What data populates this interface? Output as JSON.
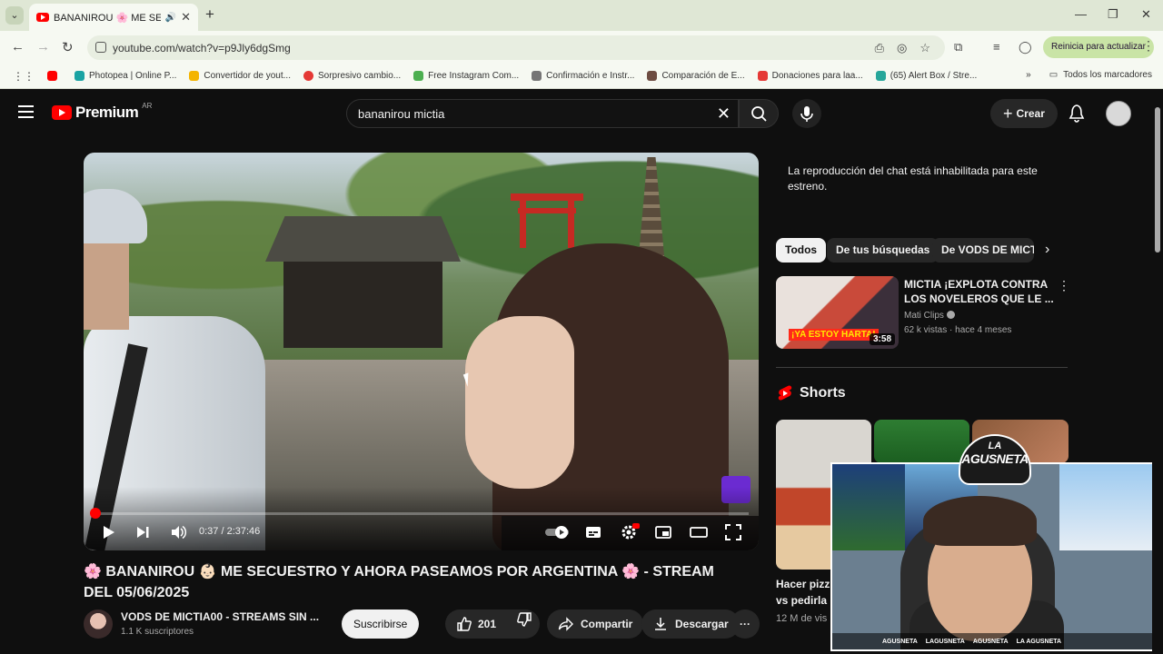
{
  "browser": {
    "tab": {
      "title": "BANANIROU 🌸 ME SE",
      "close": "✕"
    },
    "new_tab": "+",
    "url": "youtube.com/watch?v=p9Jly6dgSmg",
    "update_button": "Reinicia para actualizar",
    "bookmarks": [
      {
        "label": "",
        "color": "#ff0000"
      },
      {
        "label": "Photopea | Online P...",
        "color": "#1aa3a3"
      },
      {
        "label": "Convertidor de yout...",
        "color": "#f4b400"
      },
      {
        "label": "Sorpresivo cambio...",
        "color": "#e53935"
      },
      {
        "label": "Free Instagram Com...",
        "color": "#4caf50"
      },
      {
        "label": "Confirmación e Instr...",
        "color": "#757575"
      },
      {
        "label": "Comparación de E...",
        "color": "#6d4c41"
      },
      {
        "label": "Donaciones para laa...",
        "color": "#e53935"
      },
      {
        "label": "(65) Alert Box / Stre...",
        "color": "#26a69a"
      }
    ],
    "all_bookmarks": "Todos los marcadores"
  },
  "youtube": {
    "logo_text": "Premium",
    "logo_country": "AR",
    "search_value": "bananirou mictia",
    "create_label": "Crear"
  },
  "player": {
    "time": "0:37 / 2:37:46",
    "progress": 0.004
  },
  "video": {
    "title": "🌸 BANANIROU 👶🏻 ME SECUESTRO Y AHORA PASEAMOS POR ARGENTINA 🌸 - STREAM DEL 05/06/2025",
    "channel": "VODS DE MICTIA00 - STREAMS SIN ...",
    "subscribers": "1.1 K suscriptores",
    "subscribe_label": "Suscribirse",
    "likes": "201",
    "share_label": "Compartir",
    "download_label": "Descargar",
    "more": "···"
  },
  "sidebar": {
    "chat_notice": "La reproducción del chat está inhabilitada para este estreno.",
    "chips": [
      "Todos",
      "De tus búsquedas",
      "De VODS DE MICTI"
    ],
    "recommendation": {
      "title": "MICTIA ¡EXPLOTA CONTRA LOS NOVELEROS QUE LE ...",
      "channel": "Mati Clips",
      "meta": "62 k vistas · hace 4 meses",
      "duration": "3:58",
      "thumb_text": "¡YA ESTOY HARTA!"
    },
    "shorts_title": "Shorts",
    "short_title": "Hacer pizz\nvs pedirla",
    "short_meta": "12 M de vis"
  },
  "webcam": {
    "logo_line1": "LA",
    "logo_line2": "AGUSNETA",
    "socials": [
      "AGUSNETA",
      "LAGUSNETA",
      "AGUSNETA",
      "LA AGUSNETA"
    ]
  }
}
